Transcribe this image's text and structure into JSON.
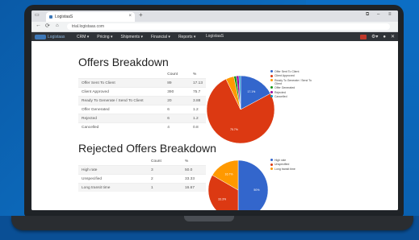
{
  "browser": {
    "tab_title": "LogistaaS",
    "url": "trial.logistaas.com",
    "app_title": "LogistaaS"
  },
  "app_nav": {
    "logo_text": "Logistaas",
    "menu": [
      "CRM ▾",
      "Pricing ▾",
      "Shipments ▾",
      "Financial ▾",
      "Reports ▾"
    ]
  },
  "offers": {
    "title": "Offers Breakdown",
    "headers": [
      "",
      "Count",
      "%"
    ],
    "rows": [
      [
        "Offer Sent To Client",
        "89",
        "17.13"
      ],
      [
        "Client Approved",
        "390",
        "75.7"
      ],
      [
        "Ready To Generate / Send To Client",
        "20",
        "3.88"
      ],
      [
        "Offer Generated",
        "6",
        "1.2"
      ],
      [
        "Rejected",
        "6",
        "1.2"
      ],
      [
        "Cancelled",
        "4",
        "0.8"
      ]
    ],
    "legend": [
      "Offer Sent To Client",
      "Client Approved",
      "Ready To Generate / Send To Client",
      "Offer Generated",
      "Rejected",
      "Cancelled"
    ]
  },
  "rejected": {
    "title": "Rejected Offers Breakdown",
    "headers": [
      "",
      "Count",
      "%"
    ],
    "rows": [
      [
        "High rate",
        "3",
        "50.0"
      ],
      [
        "Unspecified",
        "2",
        "33.33"
      ],
      [
        "Long transit time",
        "1",
        "16.67"
      ]
    ],
    "legend": [
      "High rate",
      "Unspecified",
      "Long transit time"
    ]
  },
  "colors": {
    "blue": "#3366cc",
    "red": "#dc3912",
    "orange": "#ff9900",
    "green": "#109618",
    "purple": "#990099",
    "teal": "#0099c6"
  },
  "chart_data": [
    {
      "type": "pie",
      "title": "Offers Breakdown",
      "categories": [
        "Offer Sent To Client",
        "Client Approved",
        "Ready To Generate / Send To Client",
        "Offer Generated",
        "Rejected",
        "Cancelled"
      ],
      "values": [
        17.13,
        75.7,
        3.88,
        1.2,
        1.2,
        0.8
      ],
      "slice_labels": [
        "17.1%",
        "75.7%",
        "",
        "",
        "",
        ""
      ],
      "legend_position": "right"
    },
    {
      "type": "pie",
      "title": "Rejected Offers Breakdown",
      "categories": [
        "High rate",
        "Unspecified",
        "Long transit time"
      ],
      "values": [
        50.0,
        33.33,
        16.67
      ],
      "slice_labels": [
        "50%",
        "33.3%",
        "16.7%"
      ],
      "legend_position": "right"
    }
  ]
}
